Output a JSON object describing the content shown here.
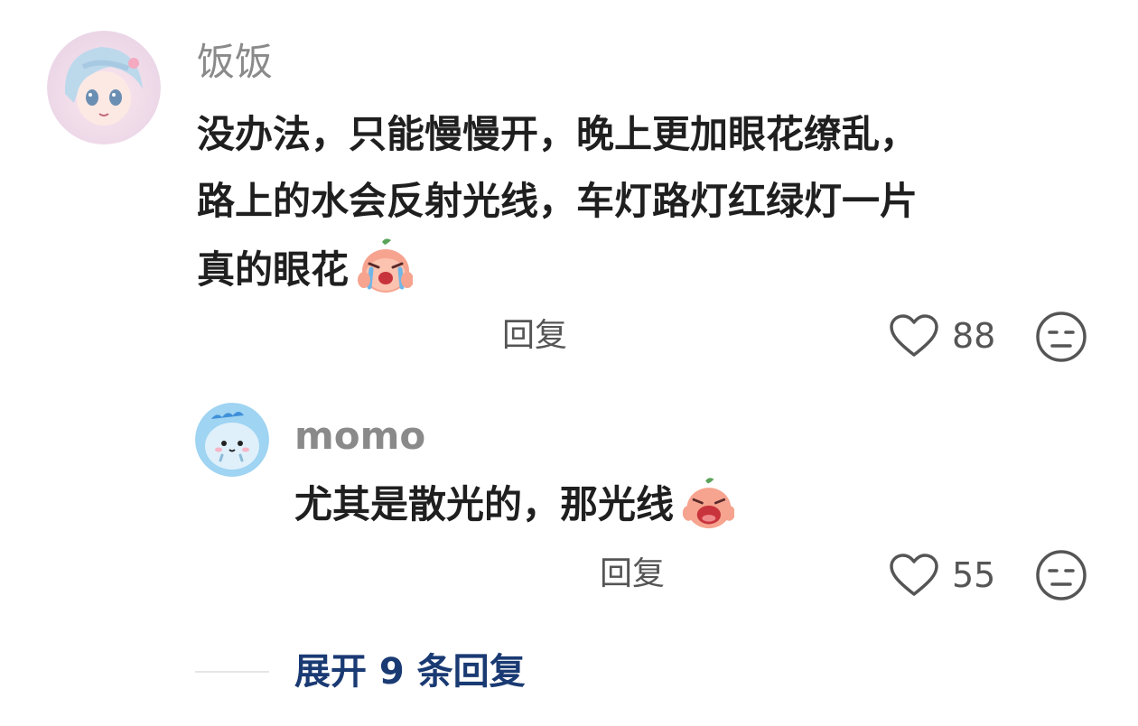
{
  "comment": {
    "username": "饭饭",
    "lines": [
      "没办法，只能慢慢开，晚上更加眼花缭乱，",
      "路上的水会反射光线，车灯路灯红绿灯一片",
      "真的眼花"
    ],
    "reply_label": "回复",
    "like_count": "88",
    "sticker": "crying-peach-sticker"
  },
  "reply": {
    "username": "momo",
    "text": "尤其是散光的，那光线",
    "reply_label": "回复",
    "like_count": "55",
    "sticker": "crying-peach-sticker"
  },
  "expand": {
    "label": "展开 9 条回复"
  },
  "icons": {
    "like": "heart-outline-icon",
    "dislike": "meh-face-icon"
  },
  "colors": {
    "username": "#8a8a8a",
    "expand_link": "#1a3a73"
  }
}
